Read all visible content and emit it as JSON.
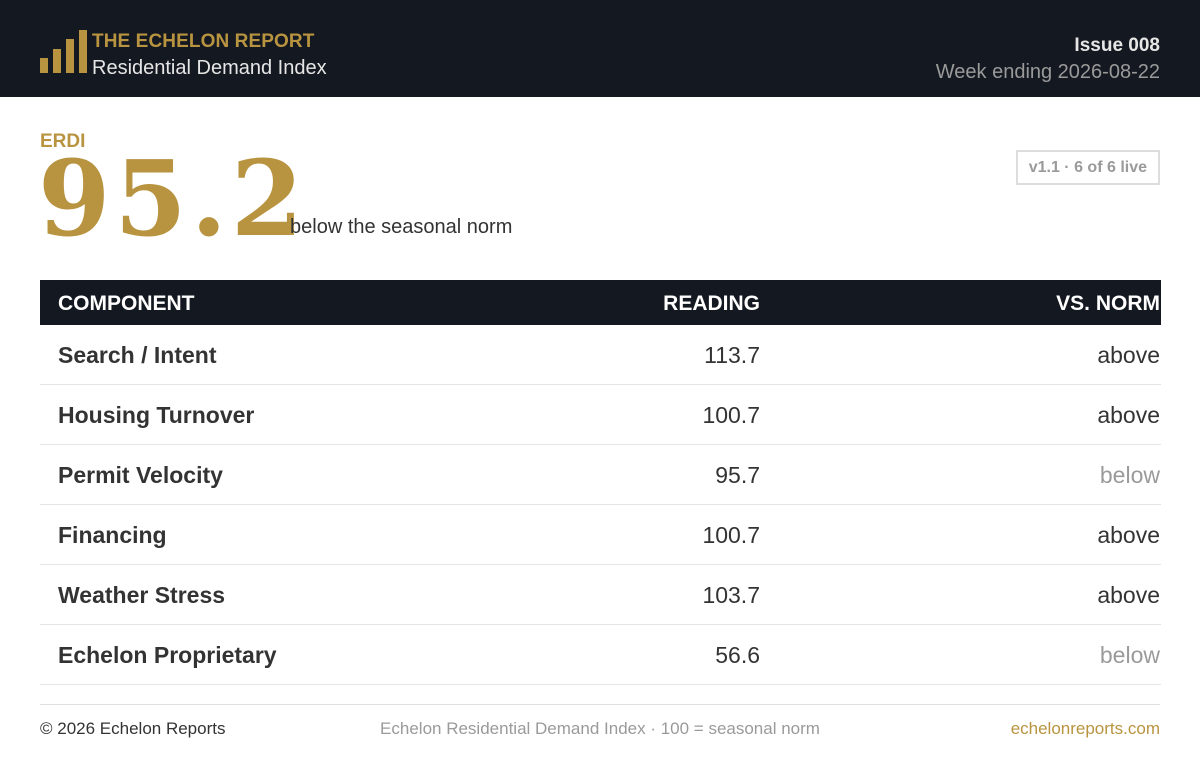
{
  "header": {
    "brand_name": "THE ECHELON REPORT",
    "brand_subtitle": "Residential Demand Index",
    "issue": "Issue 008",
    "week": "Week ending 2026-08-22",
    "logo_icon": "bar-chart-icon"
  },
  "index": {
    "label": "ERDI",
    "value": "95.2",
    "note": "below the seasonal norm",
    "version": "v1.1 · 6 of 6 live"
  },
  "table": {
    "columns": [
      "COMPONENT",
      "READING",
      "VS. NORM"
    ],
    "rows": [
      {
        "component": "Search / Intent",
        "reading": "113.7",
        "norm": "above"
      },
      {
        "component": "Housing Turnover",
        "reading": "100.7",
        "norm": "above"
      },
      {
        "component": "Permit Velocity",
        "reading": "95.7",
        "norm": "below"
      },
      {
        "component": "Financing",
        "reading": "100.7",
        "norm": "above"
      },
      {
        "component": "Weather Stress",
        "reading": "103.7",
        "norm": "above"
      },
      {
        "component": "Echelon Proprietary",
        "reading": "56.6",
        "norm": "below"
      }
    ]
  },
  "footer": {
    "copyright": "© 2026 Echelon Reports",
    "description": "Echelon Residential Demand Index · 100 = seasonal norm",
    "link": "echelonreports.com"
  },
  "colors": {
    "accent": "#b99440",
    "header_bg": "#141820",
    "muted": "#9a9a9a",
    "text": "#333333"
  }
}
